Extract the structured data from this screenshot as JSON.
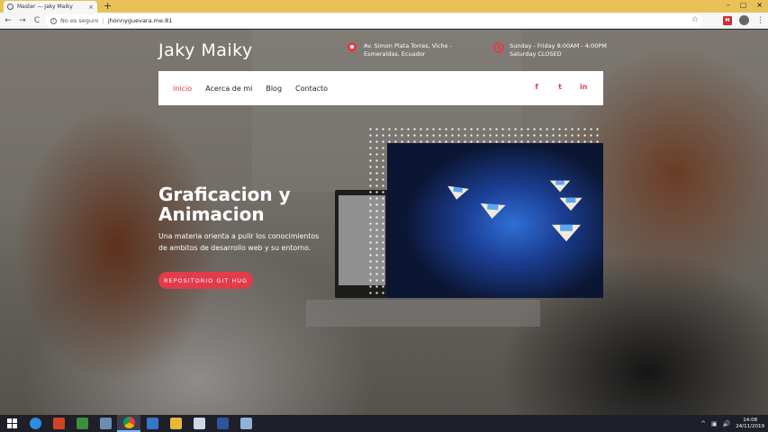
{
  "browser": {
    "tab_title": "Master — Jaky Maiky",
    "tab_close": "×",
    "new_tab": "+",
    "security_text": "No es seguro",
    "url": "jhonnyguevara.me:81",
    "star": "☆",
    "extension_badge": "M",
    "back": "←",
    "forward": "→",
    "reload": "C",
    "info": "i",
    "menu": "⋮",
    "separator": "|",
    "window_controls": [
      "–",
      "□",
      "×"
    ]
  },
  "site": {
    "brand": "Jaky Maiky",
    "address": "Av. Simon Plata Torres, Viche - Esmeraldas, Ecuador",
    "hours_line1": "Sunday - Friday 8:00AM - 4:00PM",
    "hours_line2": "Saturday CLOSED",
    "nav": [
      "Inicio",
      "Acerca de mi",
      "Blog",
      "Contacto"
    ],
    "social": [
      "f",
      "t",
      "in"
    ],
    "social_icons": [
      "facebook-icon",
      "twitter-icon",
      "linkedin-icon"
    ],
    "hero_title": "Graficacion y Animacion",
    "hero_subtitle": "Una materia orienta a pulir los conocimientos de ambitos de desarrollo web y su entorno.",
    "hero_button": "REPOSITORIO GIT HUG",
    "accent_color": "#e23b4a"
  },
  "taskbar": {
    "apps": [
      "ie-icon",
      "powerpoint-icon",
      "project-icon",
      "network-icon",
      "chrome-icon",
      "tool-icon",
      "file-explorer-icon",
      "paint-icon",
      "word-icon",
      "folder-icon"
    ],
    "tray_arrow": "^",
    "tray_volume": "🔊",
    "tray_network": "▣",
    "time": "14:08",
    "date": "24/11/2019"
  }
}
